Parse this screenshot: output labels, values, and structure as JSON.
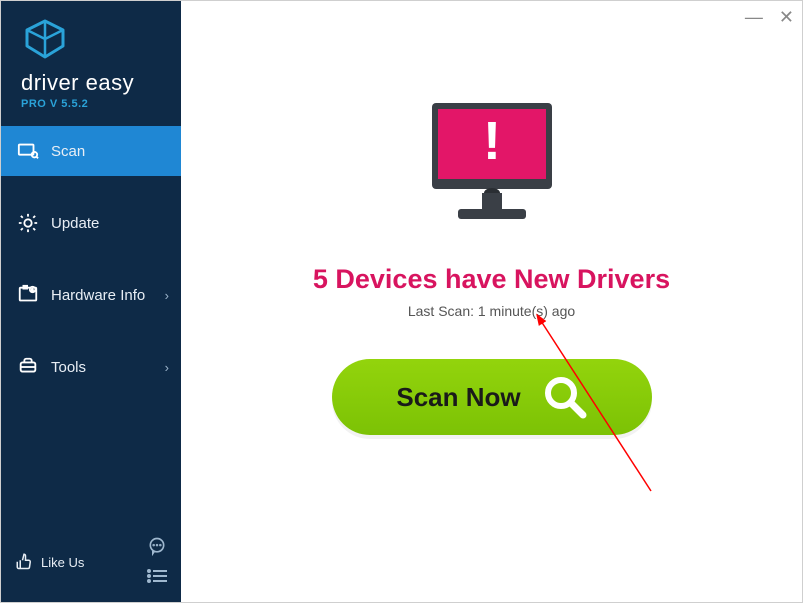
{
  "brand": {
    "name": "driver easy",
    "version_label": "PRO V 5.5.2"
  },
  "sidebar": {
    "items": [
      {
        "label": "Scan",
        "has_chevron": false
      },
      {
        "label": "Update",
        "has_chevron": false
      },
      {
        "label": "Hardware Info",
        "has_chevron": true
      },
      {
        "label": "Tools",
        "has_chevron": true
      }
    ],
    "like_us_label": "Like Us"
  },
  "main": {
    "headline": "5 Devices have New Drivers",
    "last_scan": "Last Scan: 1 minute(s) ago",
    "scan_button_label": "Scan Now"
  },
  "colors": {
    "sidebar_bg": "#0e2a47",
    "active_bg": "#1f87d4",
    "accent_pink": "#d8145f",
    "button_green": "#8fcf09"
  }
}
